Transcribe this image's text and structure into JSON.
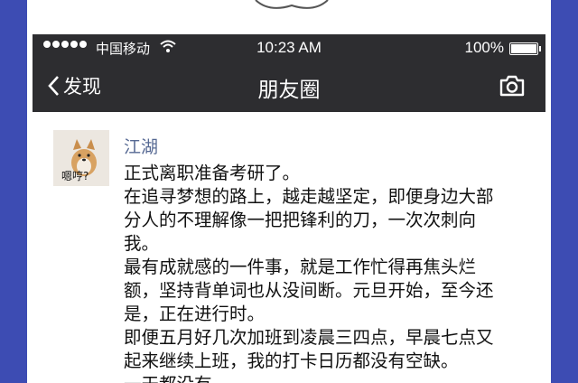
{
  "status_bar": {
    "carrier": "中国移动",
    "time": "10:23 AM",
    "battery": "100%"
  },
  "nav": {
    "back_label": "发现",
    "title": "朋友圈"
  },
  "post": {
    "avatar_caption": "嗯哼?",
    "username": "江湖",
    "lines": [
      "正式离职准备考研了。",
      "在追寻梦想的路上，越走越坚定，即便身边大部",
      "分人的不理解像一把把锋利的刀，一次次刺向",
      "我。",
      "最有成就感的一件事，就是工作忙得再焦头烂",
      "额，坚持背单词也从没间断。元旦开始，至今还",
      "是，正在进行时。",
      "即便五月好几次加班到凌晨三四点，早晨七点又",
      "起来继续上班，我的打卡日历都没有空缺。",
      "一天都没有。"
    ]
  },
  "colors": {
    "page_border": "#3d4cb3",
    "bar": "#2d2d30",
    "username": "#566993"
  }
}
